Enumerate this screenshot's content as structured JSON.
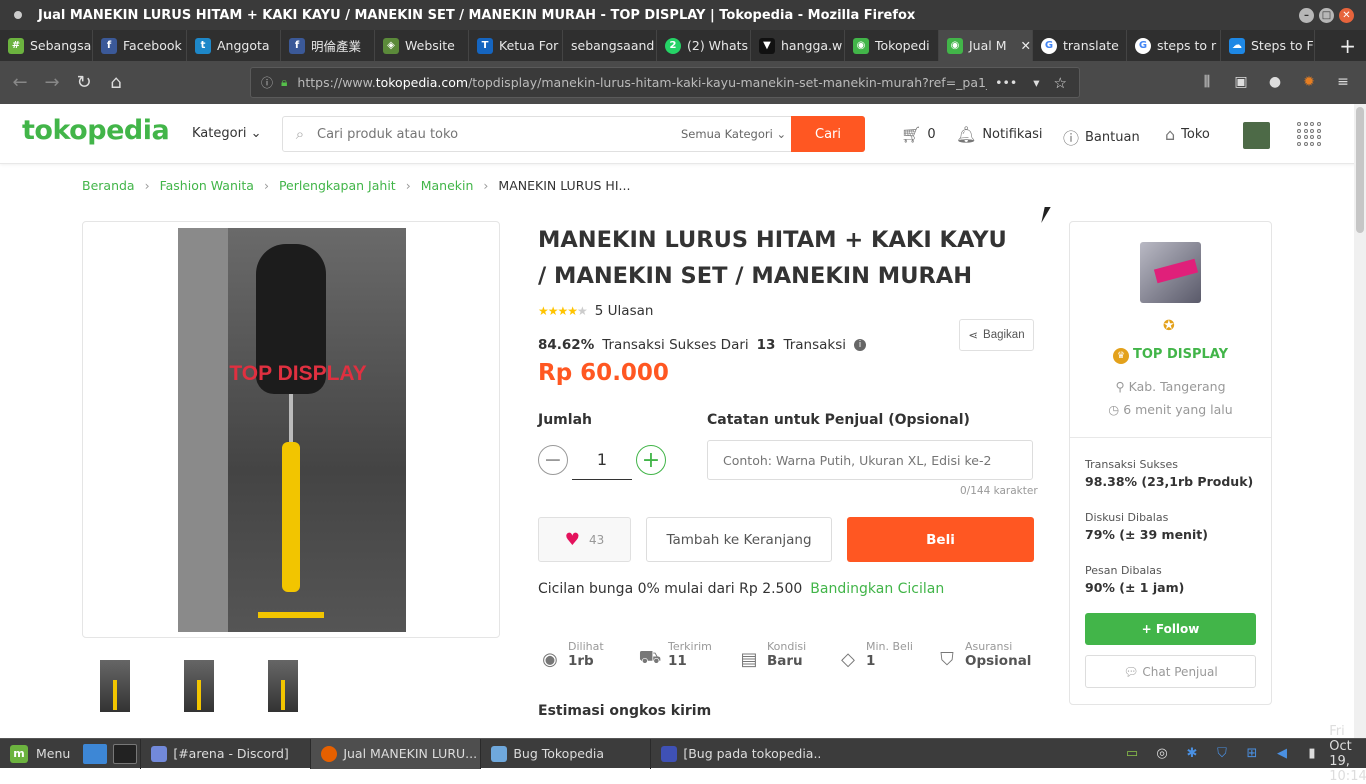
{
  "window": {
    "title": "Jual MANEKIN LURUS HITAM + KAKI KAYU / MANEKIN SET / MANEKIN MURAH - TOP DISPLAY | Tokopedia - Mozilla Firefox"
  },
  "tabs": [
    {
      "label": "Sebangsa",
      "icon": "sebangsa-icon",
      "color": "#6cb33f"
    },
    {
      "label": "Facebook",
      "icon": "facebook-icon",
      "color": "#3b5998"
    },
    {
      "label": "Anggota",
      "icon": "tribun-icon",
      "color": "#1e88c9"
    },
    {
      "label": "明倫產業",
      "icon": "facebook-icon",
      "color": "#3b5998"
    },
    {
      "label": "Website",
      "icon": "website-icon",
      "color": "#5b8a3a"
    },
    {
      "label": "Ketua For",
      "icon": "telegraph-icon",
      "color": "#1565c0"
    },
    {
      "label": "sebangsaand",
      "icon": "blank-icon",
      "color": "#2f2f2f"
    },
    {
      "label": "(2) Whats",
      "icon": "whatsapp-icon",
      "color": "#25d366"
    },
    {
      "label": "hangga.w",
      "icon": "hangga-icon",
      "color": "#222222"
    },
    {
      "label": "Tokopedi",
      "icon": "tokopedia-icon",
      "color": "#42b549"
    },
    {
      "label": "Jual M",
      "icon": "tokopedia-icon",
      "color": "#42b549",
      "active": true
    },
    {
      "label": "translate",
      "icon": "google-icon",
      "color": "#ffffff"
    },
    {
      "label": "steps to r",
      "icon": "google-icon",
      "color": "#ffffff"
    },
    {
      "label": "Steps to F",
      "icon": "steps-icon",
      "color": "#1e88e5"
    }
  ],
  "toolbar": {
    "url_prefix": "https://www.",
    "url_domain": "tokopedia.com",
    "url_path": "/topdisplay/manekin-lurus-hitam-kaki-kayu-manekin-set-manekin-murah?ref=_pa1_po1"
  },
  "header": {
    "logo": "tokopedia",
    "kategori": "Kategori",
    "search_placeholder": "Cari produk atau toko",
    "search_category": "Semua Kategori",
    "search_button": "Cari",
    "cart_count": "0",
    "notifikasi": "Notifikasi",
    "bantuan": "Bantuan",
    "toko": "Toko"
  },
  "breadcrumb": [
    "Beranda",
    "Fashion Wanita",
    "Perlengkapan Jahit",
    "Manekin",
    "MANEKIN LURUS HI..."
  ],
  "product": {
    "watermark": "TOP DISPLAY",
    "title": "MANEKIN LURUS HITAM + KAKI KAYU / MANEKIN SET / MANEKIN MURAH",
    "rating_stars": 4,
    "reviews": "5 Ulasan",
    "success_rate": "84.62%",
    "success_text": "Transaksi Sukses Dari",
    "transactions": "13",
    "transactions_label": "Transaksi",
    "share": "Bagikan",
    "price": "Rp 60.000",
    "jumlah_label": "Jumlah",
    "qty": "1",
    "note_label": "Catatan untuk Penjual (Opsional)",
    "note_placeholder": "Contoh: Warna Putih, Ukuran XL, Edisi ke-2",
    "note_counter": "0/144 karakter",
    "wishlist_count": "43",
    "add_to_cart": "Tambah ke Keranjang",
    "buy": "Beli",
    "cicilan_text": "Cicilan bunga 0% mulai dari Rp 2.500",
    "cicilan_link": "Bandingkan Cicilan",
    "stats": [
      {
        "label": "Dilihat",
        "value": "1rb",
        "icon": "eye-icon"
      },
      {
        "label": "Terkirim",
        "value": "11",
        "icon": "truck-icon"
      },
      {
        "label": "Kondisi",
        "value": "Baru",
        "icon": "box-icon"
      },
      {
        "label": "Min. Beli",
        "value": "1",
        "icon": "tag-icon"
      },
      {
        "label": "Asuransi",
        "value": "Opsional",
        "icon": "shield-icon"
      }
    ],
    "ongkos_label": "Estimasi ongkos kirim"
  },
  "shop": {
    "name": "TOP DISPLAY",
    "location": "Kab. Tangerang",
    "last_online": "6 menit yang lalu",
    "stats": [
      {
        "label": "Transaksi Sukses",
        "value": "98.38% (23,1rb Produk)"
      },
      {
        "label": "Diskusi Dibalas",
        "value": "79% (± 39 menit)"
      },
      {
        "label": "Pesan Dibalas",
        "value": "90% (± 1 jam)"
      }
    ],
    "follow": "Follow",
    "chat": "Chat Penjual"
  },
  "taskbar": {
    "menu": "Menu",
    "tasks": [
      {
        "label": "[#arena - Discord]",
        "color": "#7289da"
      },
      {
        "label": "Jual MANEKIN LURU...",
        "color": "#e66000",
        "active": true
      },
      {
        "label": "Bug Tokopedia",
        "color": "#6fa8dc"
      },
      {
        "label": "[Bug pada tokopedia...",
        "color": "#3f51b5"
      }
    ],
    "clock": "Fri Oct 19, 10:14"
  }
}
